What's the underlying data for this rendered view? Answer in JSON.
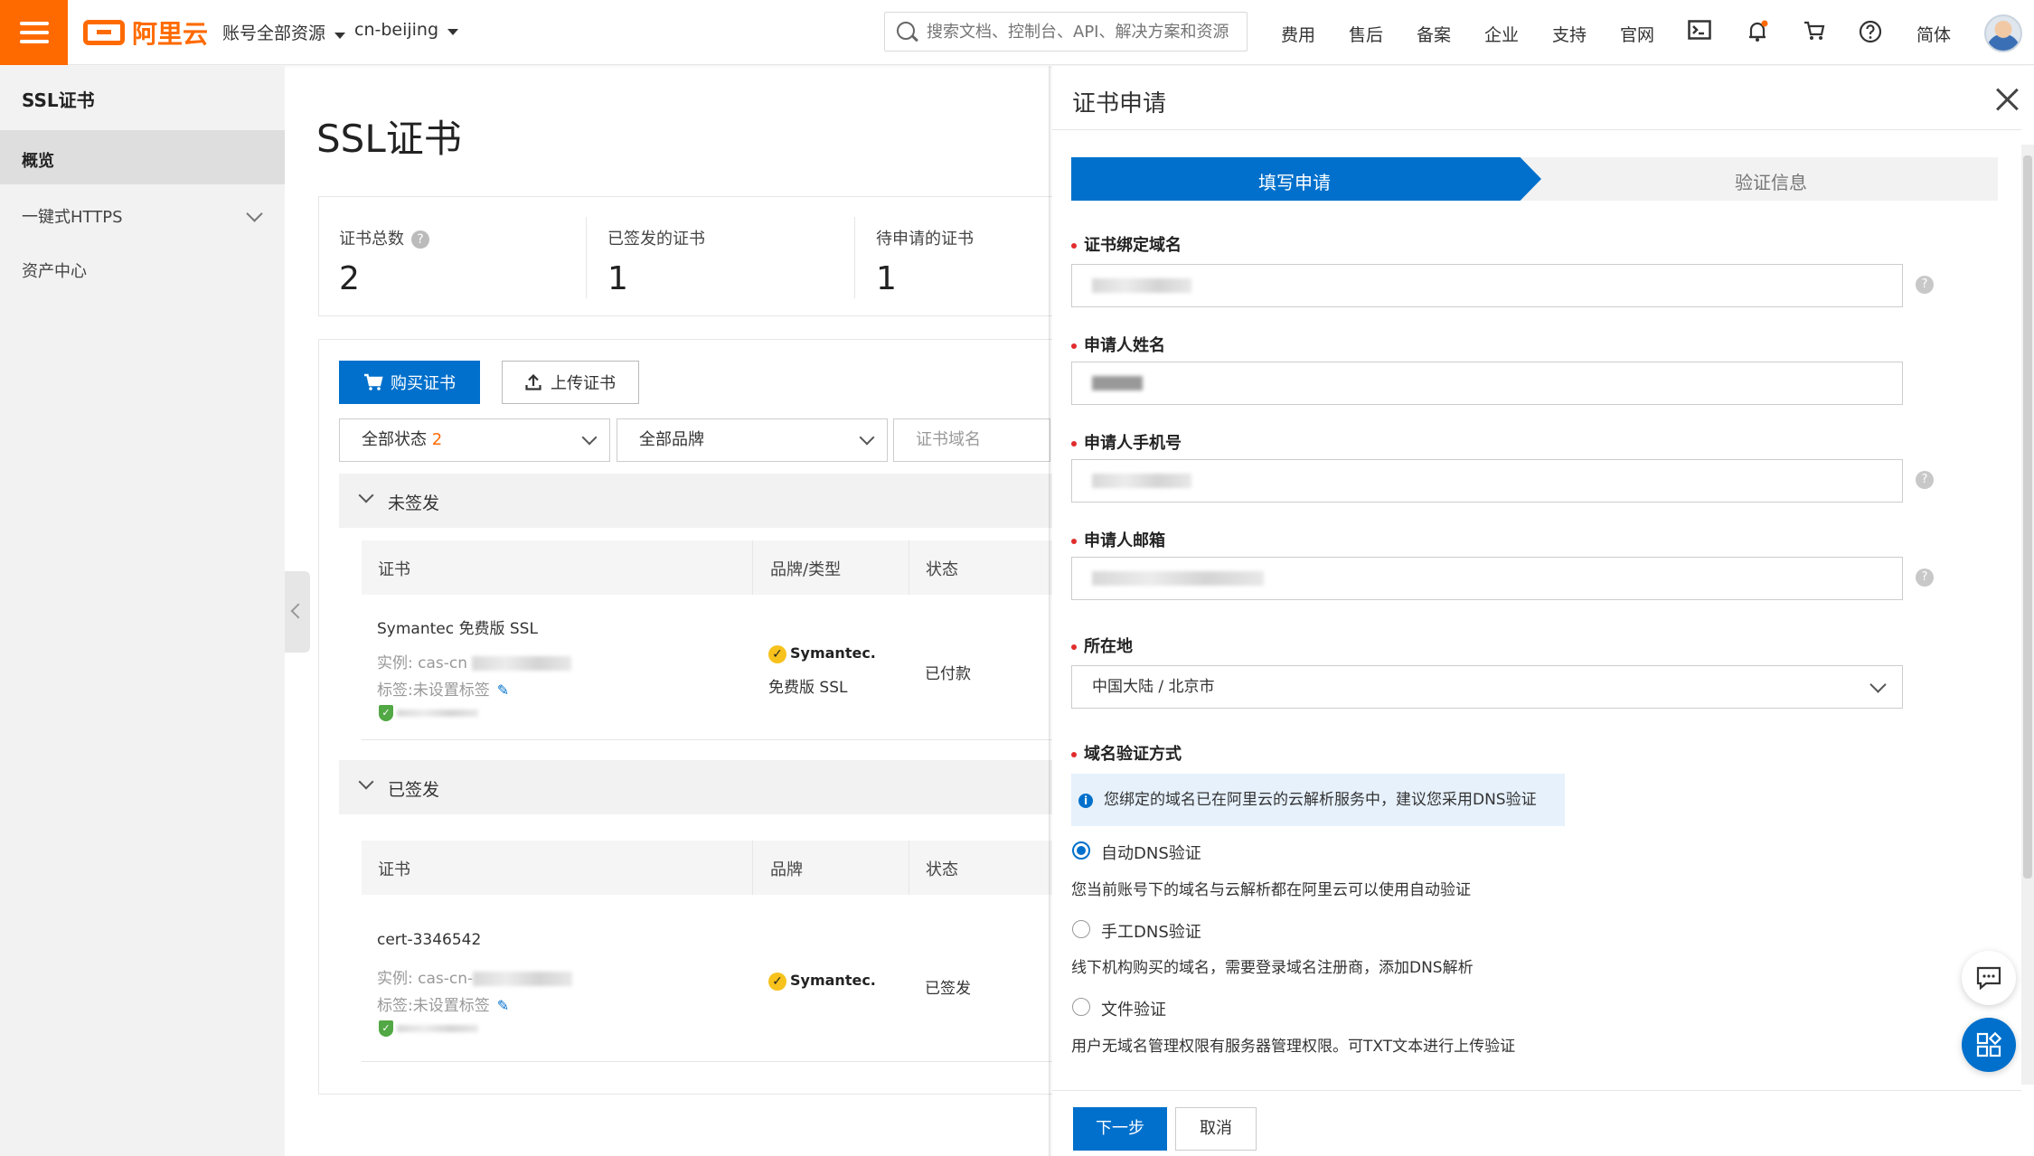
{
  "topbar": {
    "logo_text": "阿里云",
    "account_label": "账号全部资源",
    "region_label": "cn-beijing",
    "search_placeholder": "搜索文档、控制台、API、解决方案和资源",
    "nav": [
      "费用",
      "售后",
      "备案",
      "企业",
      "支持",
      "官网"
    ],
    "lang": "简体"
  },
  "sidebar": {
    "title": "SSL证书",
    "items": [
      {
        "label": "概览",
        "active": true
      },
      {
        "label": "一键式HTTPS"
      },
      {
        "label": "资产中心"
      }
    ]
  },
  "main": {
    "title": "SSL证书",
    "stats": [
      {
        "label": "证书总数",
        "value": "2"
      },
      {
        "label": "已签发的证书",
        "value": "1"
      },
      {
        "label": "待申请的证书",
        "value": "1"
      }
    ],
    "buy_label": "购买证书",
    "upload_label": "上传证书",
    "filters": {
      "status": "全部状态",
      "status_count": "2",
      "brand": "全部品牌",
      "domain_placeholder": "证书域名"
    },
    "groups": [
      {
        "title": "未签发",
        "columns": [
          "证书",
          "品牌/类型",
          "状态"
        ],
        "row": {
          "name": "Symantec 免费版 SSL",
          "instance_prefix": "实例: cas-cn",
          "tags": "标签:未设置标签",
          "brand": "Symantec.",
          "brand_type": "免费版 SSL",
          "status": "已付款"
        }
      },
      {
        "title": "已签发",
        "columns": [
          "证书",
          "品牌",
          "状态"
        ],
        "row": {
          "name": "cert-3346542",
          "instance_prefix": "实例: cas-cn-",
          "tags": "标签:未设置标签",
          "brand": "Symantec.",
          "status": "已签发"
        }
      }
    ]
  },
  "drawer": {
    "title": "证书申请",
    "steps": [
      "填写申请",
      "验证信息"
    ],
    "fields": {
      "domain_label": "证书绑定域名",
      "name_label": "申请人姓名",
      "phone_label": "申请人手机号",
      "email_label": "申请人邮箱",
      "location_label": "所在地",
      "location_value": "中国大陆 / 北京市",
      "verify_label": "域名验证方式"
    },
    "tip": "您绑定的域名已在阿里云的云解析服务中，建议您采用DNS验证",
    "options": [
      {
        "label": "自动DNS验证",
        "desc": "您当前账号下的域名与云解析都在阿里云可以使用自动验证",
        "checked": true
      },
      {
        "label": "手工DNS验证",
        "desc": "线下机构购买的域名，需要登录域名注册商，添加DNS解析",
        "checked": false
      },
      {
        "label": "文件验证",
        "desc": "用户无域名管理权限有服务器管理权限。可TXT文本进行上传验证",
        "checked": false
      }
    ],
    "next_label": "下一步",
    "cancel_label": "取消"
  },
  "colors": {
    "brand_orange": "#ff6a00",
    "primary_blue": "#0070cc",
    "required_red": "#e12c2c"
  }
}
